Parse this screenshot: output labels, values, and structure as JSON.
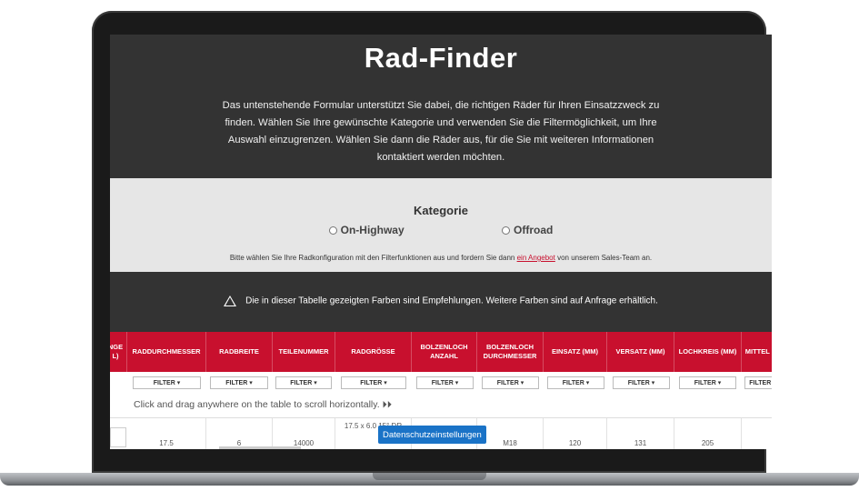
{
  "header": {
    "title": "Rad-Finder",
    "intro": "Das untenstehende Formular unterstützt Sie dabei, die richtigen Räder für Ihren Einsatzzweck zu finden. Wählen Sie Ihre gewünschte Kategorie und verwenden Sie die Filtermöglichkeit, um Ihre Auswahl einzugrenzen. Wählen Sie dann die Räder aus, für die Sie mit weiteren Informationen kontaktiert werden möchten."
  },
  "category": {
    "title": "Kategorie",
    "options": [
      "On-Highway",
      "Offroad"
    ],
    "hint_before": "Bitte wählen Sie Ihre Radkonfiguration mit den Filterfunktionen aus und fordern Sie dann",
    "hint_link": "ein Angebot",
    "hint_after": "von unserem Sales-Team an."
  },
  "notice": {
    "icon": "warning-icon",
    "text": "Die in dieser Tabelle gezeigten Farben sind Empfehlungen. Weitere Farben sind auf Anfrage erhältlich."
  },
  "table": {
    "columns": [
      "NGE L)",
      "RADDURCHMESSER",
      "RADBREITE",
      "TEILENUMMER",
      "RADGRÖSSE",
      "BOLZENLOCH ANZAHL",
      "BOLZENLOCH DURCHMESSER",
      "EINSATZ (MM)",
      "VERSATZ (MM)",
      "LOCHKREIS (MM)",
      "MITTEL ("
    ],
    "filter_label": "FILTER ▾",
    "drag_hint": "Click and drag anywhere on the table to scroll horizontally. ⏵⏵",
    "rows": [
      [
        "",
        "17.5",
        "6",
        "14000",
        "17.5 x 6.0 15° DR",
        "",
        "M18",
        "120",
        "131",
        "205",
        ""
      ]
    ]
  },
  "cookie_button": "Datenschutzeinstellungen",
  "colors": {
    "accent": "#c8102e",
    "dark": "#333333",
    "light": "#e6e6e6",
    "cookie": "#1a73c7"
  }
}
